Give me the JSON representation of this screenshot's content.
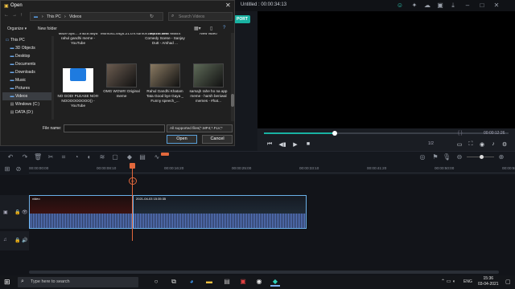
{
  "editor": {
    "title": "Untitled : 00:00:34:13",
    "export_label": "PORT",
    "preview_time": "00:00:12:26",
    "preview_brackets": "{    }",
    "progress": 0.29,
    "ratio": "1/2",
    "ruler_ticks": [
      "00:00:00:00",
      "00:00:08:10",
      "00:00:16:20",
      "00:00:25:00",
      "00:00:33:10",
      "00:00:41:20",
      "00:00:50:00",
      "00:00:58:10"
    ],
    "clip1_label": "video",
    "clip2_label": "2021-04-03 15:35:35",
    "playhead_badge": "00"
  },
  "dialog": {
    "title": "Open",
    "address_crumbs": [
      "This PC",
      "Videos"
    ],
    "search_placeholder": "Search Videos",
    "organize_label": "Organize ▾",
    "new_folder_label": "New folder",
    "nav": [
      {
        "label": "This PC",
        "icon": "pc-icon"
      },
      {
        "label": "3D Objects",
        "icon": "folder-icon"
      },
      {
        "label": "Desktop",
        "icon": "folder-icon"
      },
      {
        "label": "Documents",
        "icon": "folder-icon"
      },
      {
        "label": "Downloads",
        "icon": "folder-icon"
      },
      {
        "label": "Music",
        "icon": "folder-icon"
      },
      {
        "label": "Pictures",
        "icon": "folder-icon"
      },
      {
        "label": "Videos",
        "icon": "folder-icon"
      },
      {
        "label": "Windows (C:)",
        "icon": "drive-icon"
      },
      {
        "label": "DATA (D:)",
        "icon": "drive-icon"
      }
    ],
    "files_row1": [
      {
        "name": "Maze aya.....maza aaya rahul gandhi meme - YouTube",
        "thumb": "#3a2a22"
      },
      {
        "name": "Mumb41.54g4.21.cm.sdm0v1bq01nt.dev",
        "thumb": "#2d2424"
      },
      {
        "name": "Munna Bhai MBBS Comedy Scene - Sanjay Dutt - Arshad ...",
        "thumb": "#3a3327"
      },
      {
        "name": "New video",
        "thumb": "#2a2a2a"
      }
    ],
    "files_row2": [
      {
        "name": "NO GOD! PLEASE NO!!! NOOOOOOOOO() - YouTube",
        "thumb": "clapper"
      },
      {
        "name": "OMG WOW!!! Original meme",
        "thumb": "#6b5c50"
      },
      {
        "name": "Rahul Gandhi Khatam Tata Good bye Gaya _ Funny speech_...",
        "thumb": "#8a7a62"
      },
      {
        "name": "samajh rahe ho na app meme - harsh beniwal memes - #hat...",
        "thumb": "#5e6a58"
      }
    ],
    "file_name_label": "File name:",
    "file_name_value": "",
    "file_type": "All supported files(*.MP4;*.FLV;*",
    "open_label": "Open",
    "cancel_label": "Cancel"
  },
  "taskbar": {
    "search_placeholder": "Type here to search",
    "time": "15:36",
    "date": "03-04-2021",
    "lang": "ENG"
  }
}
